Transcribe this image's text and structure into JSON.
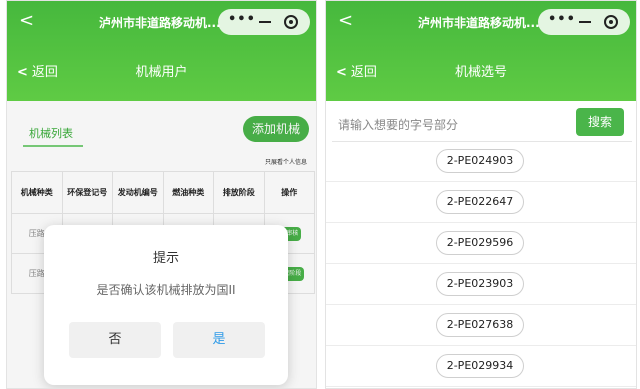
{
  "left": {
    "window_title": "泸州市非道路移动机...",
    "nav": {
      "back_label": "返回",
      "title": "机械用户"
    },
    "tab_label": "机械列表",
    "add_button": "添加机械",
    "info_link": "只展看个人信息",
    "table": {
      "headers": [
        "机械种类",
        "环保登记号",
        "发动机编号",
        "燃油种类",
        "排放阶段",
        "操作"
      ],
      "rows": [
        {
          "type": "压路",
          "action": "变审核"
        },
        {
          "type": "压路",
          "action": "排放阶段"
        }
      ]
    },
    "dialog": {
      "title": "提示",
      "message": "是否确认该机械排放为国II",
      "no_label": "否",
      "yes_label": "是"
    }
  },
  "right": {
    "window_title": "泸州市非道路移动机...",
    "nav": {
      "back_label": "返回",
      "title": "机械选号"
    },
    "search": {
      "placeholder": "请输入想要的字号部分",
      "button_label": "搜索"
    },
    "plates": [
      "2-PE024903",
      "2-PE022647",
      "2-PE029596",
      "2-PE023903",
      "2-PE027638",
      "2-PE029934"
    ]
  },
  "capsule": {
    "more_icon": "more-dots-icon",
    "minimize_icon": "minimize-icon",
    "close_icon": "close-circle-icon"
  },
  "colors": {
    "header_green": "#4fbf40",
    "button_green": "#4ab54a",
    "confirm_blue": "#2f9be8"
  }
}
